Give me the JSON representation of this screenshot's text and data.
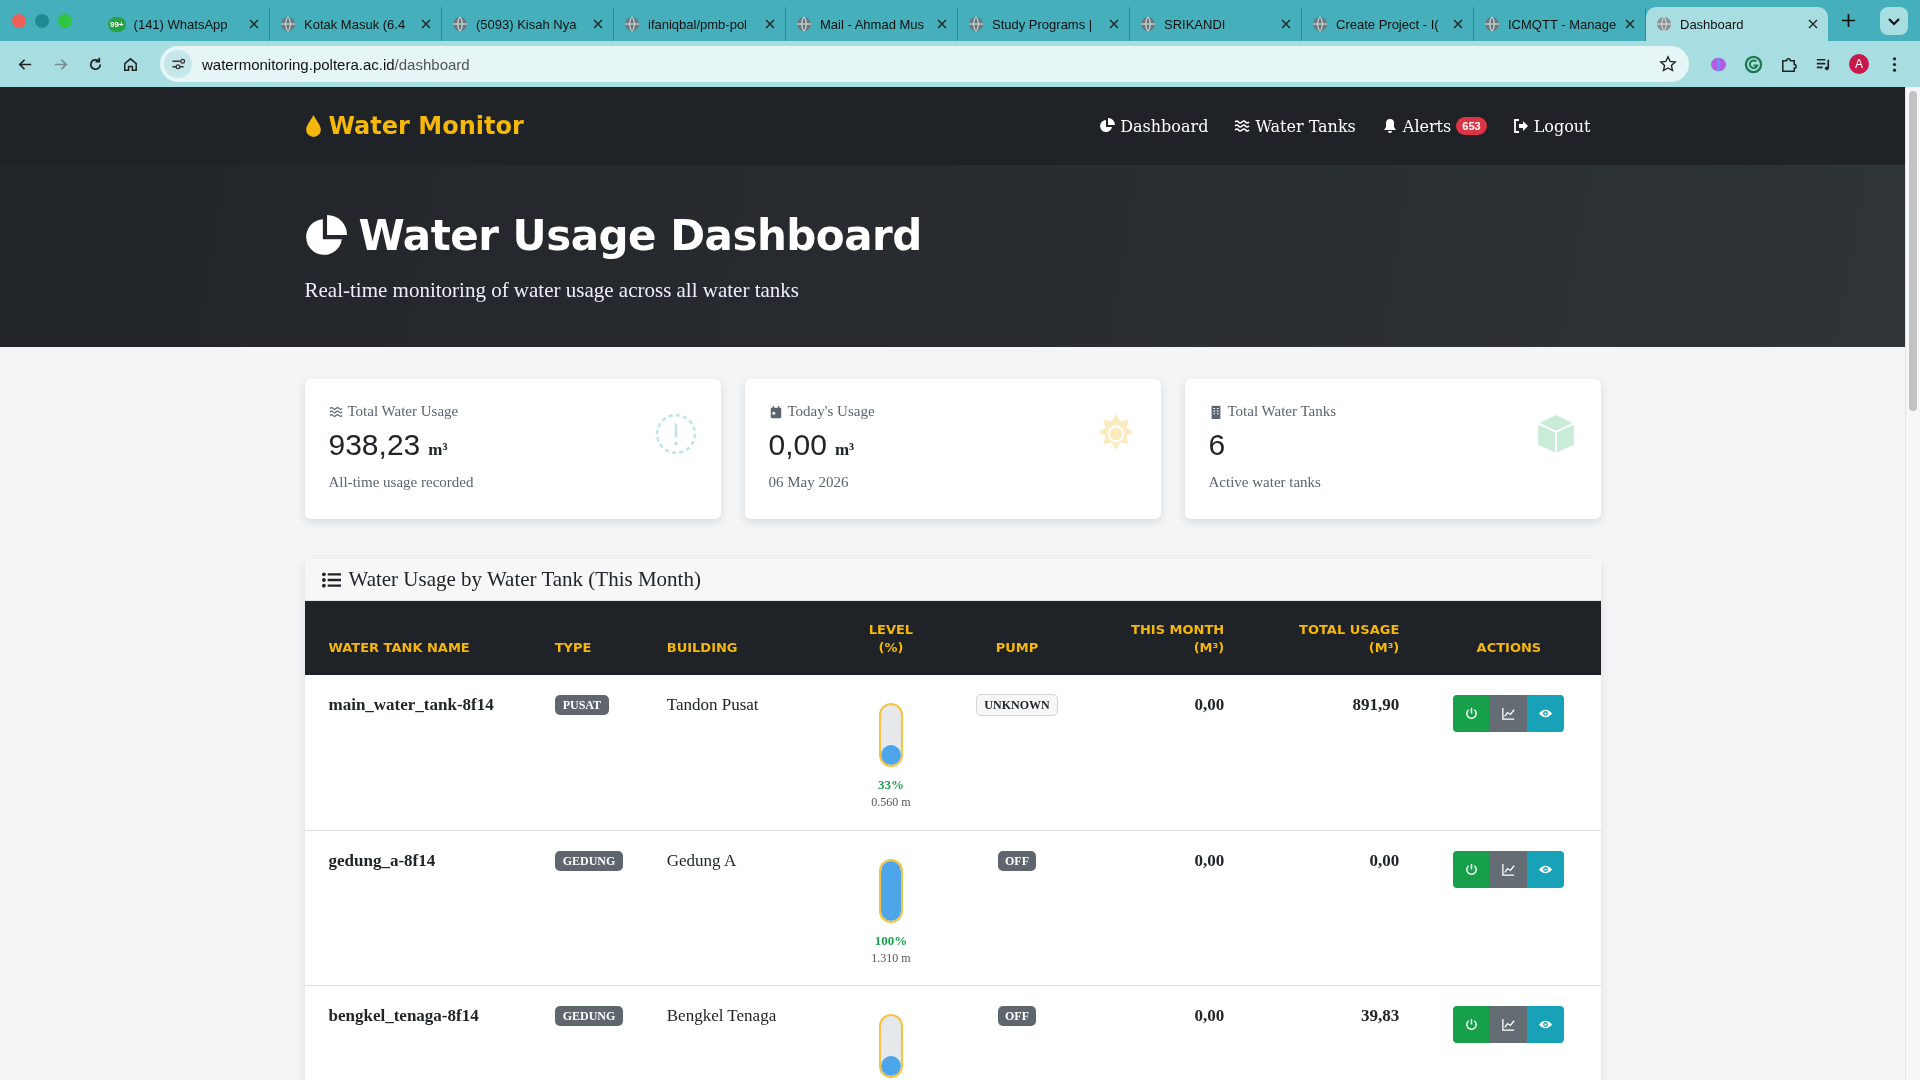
{
  "browser": {
    "tabs": [
      {
        "title": "(141) WhatsApp",
        "badge": "99+",
        "selected": false
      },
      {
        "title": "Kotak Masuk (6.4",
        "selected": false
      },
      {
        "title": "(5093) Kisah Nya",
        "selected": false
      },
      {
        "title": "ifaniqbal/pmb-pol",
        "selected": false
      },
      {
        "title": "Mail - Ahmad Mus",
        "selected": false
      },
      {
        "title": "Study Programs |",
        "selected": false
      },
      {
        "title": "SRIKANDI",
        "selected": false
      },
      {
        "title": "Create Project - I(",
        "selected": false
      },
      {
        "title": "ICMQTT - Manage",
        "selected": false
      },
      {
        "title": "Dashboard",
        "selected": true
      }
    ],
    "url_host": "watermonitoring.poltera.ac.id",
    "url_path": "/dashboard",
    "profile": "A"
  },
  "navbar": {
    "brand": "Water Monitor",
    "links": [
      {
        "label": "Dashboard",
        "kind": "dashboard"
      },
      {
        "label": "Water Tanks",
        "kind": "tanks"
      },
      {
        "label": "Alerts",
        "kind": "alerts",
        "badge": "653"
      },
      {
        "label": "Logout",
        "kind": "logout"
      }
    ]
  },
  "hero": {
    "title": "Water Usage Dashboard",
    "subtitle": "Real-time monitoring of water usage across all water tanks"
  },
  "cards": [
    {
      "kind": "usage",
      "label": "Total Water Usage",
      "value": "938,23",
      "unit": "m³",
      "note": "All-time usage recorded"
    },
    {
      "kind": "today",
      "label": "Today's Usage",
      "value": "0,00",
      "unit": "m³",
      "note": "06 May 2026"
    },
    {
      "kind": "tanks",
      "label": "Total Water Tanks",
      "value": "6",
      "note": "Active water tanks"
    }
  ],
  "table": {
    "title": "Water Usage by Water Tank (This Month)",
    "columns": [
      [
        "WATER TANK NAME"
      ],
      [
        "TYPE"
      ],
      [
        "BUILDING"
      ],
      [
        "LEVEL",
        "(%)"
      ],
      [
        "PUMP"
      ],
      [
        "THIS MONTH",
        "(M³)"
      ],
      [
        "TOTAL USAGE",
        "(M³)"
      ],
      [
        "ACTIONS"
      ]
    ],
    "rows": [
      {
        "name": "main_water_tank-8f14",
        "type": "PUSAT",
        "building": "Tandon Pusat",
        "level": 0.33,
        "percent": "33%",
        "height": "0.560 m",
        "pump": {
          "label": "UNKNOWN",
          "kind": "outline"
        },
        "this_month": "0,00",
        "total": "891,90"
      },
      {
        "name": "gedung_a-8f14",
        "type": "GEDUNG",
        "building": "Gedung A",
        "level": 1.0,
        "percent": "100%",
        "height": "1.310 m",
        "pump": {
          "label": "OFF",
          "kind": "dark"
        },
        "this_month": "0,00",
        "total": "0,00"
      },
      {
        "name": "bengkel_tenaga-8f14",
        "type": "GEDUNG",
        "building": "Bengkel Tenaga",
        "level": 0.33,
        "pump": {
          "label": "OFF",
          "kind": "dark"
        },
        "this_month": "0,00",
        "total": "39,83"
      }
    ]
  }
}
